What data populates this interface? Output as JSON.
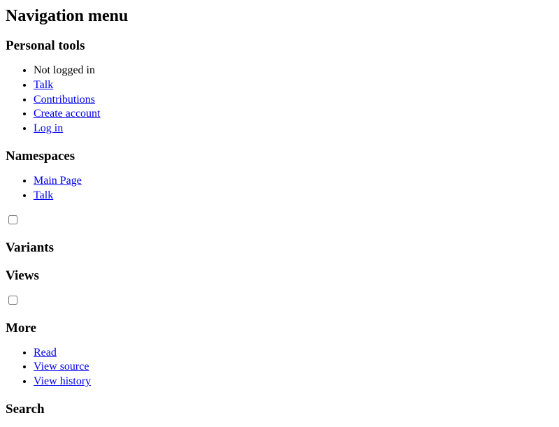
{
  "nav": {
    "heading": "Navigation menu",
    "sections": {
      "personal_tools": {
        "heading": "Personal tools",
        "items": [
          {
            "label": "Not logged in",
            "link": false
          },
          {
            "label": "Talk",
            "link": true
          },
          {
            "label": "Contributions",
            "link": true
          },
          {
            "label": "Create account",
            "link": true
          },
          {
            "label": "Log in",
            "link": true
          }
        ]
      },
      "namespaces": {
        "heading": "Namespaces",
        "items": [
          {
            "label": "Main Page",
            "link": true
          },
          {
            "label": "Talk",
            "link": true
          }
        ]
      },
      "variants": {
        "heading": "Variants",
        "checkbox_checked": false
      },
      "views": {
        "heading": "Views"
      },
      "more": {
        "heading": "More",
        "checkbox_checked": false,
        "items": [
          {
            "label": "Read",
            "link": true
          },
          {
            "label": "View source",
            "link": true
          },
          {
            "label": "View history",
            "link": true
          }
        ]
      },
      "search": {
        "heading": "Search"
      }
    }
  }
}
